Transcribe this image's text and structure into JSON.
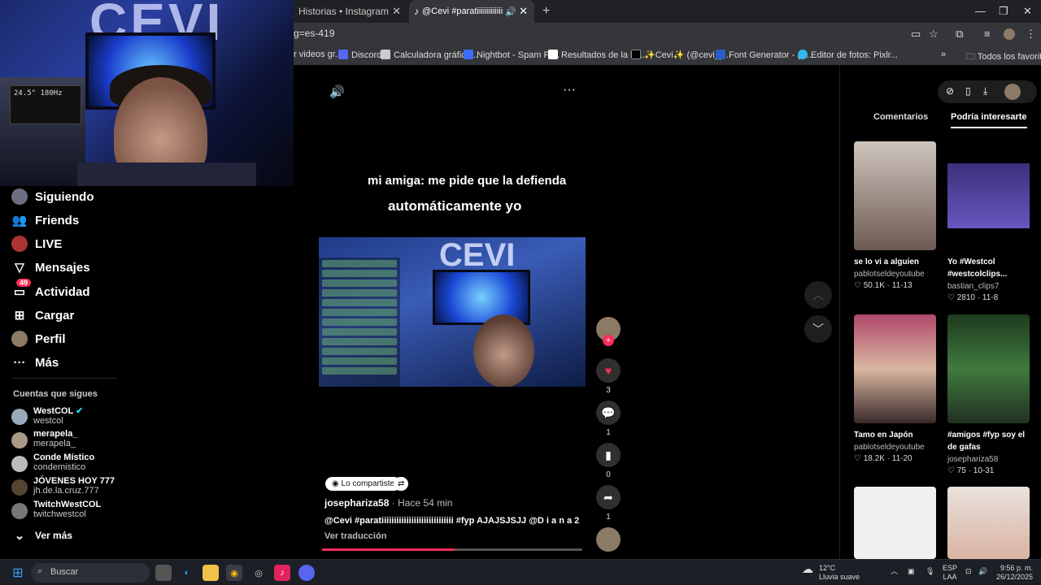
{
  "webcam": {
    "logo": "CEVI",
    "box_text": "24.5\" 180Hz"
  },
  "browser": {
    "tabs": [
      {
        "title": "Historias • Instagram"
      },
      {
        "title": "@Cevi #paratiiiiiiiiiiiiiiiiiiiiiiiiiiiiii"
      }
    ],
    "new_tab": "+",
    "url": "g=es-419",
    "bookmarks": [
      {
        "label": "r videos gr...",
        "color": "#888888"
      },
      {
        "label": "Discord",
        "color": "#5865f2"
      },
      {
        "label": "Calculadora gráfica...",
        "color": "#cccccc"
      },
      {
        "label": "Nightbot - Spam Pr...",
        "color": "#3b6cff"
      },
      {
        "label": "Resultados de la bú...",
        "color": "#ffffff"
      },
      {
        "label": "✨Cevi✨ (@cevi_y...",
        "color": "#000000"
      },
      {
        "label": "Font Generator - (ℭ...",
        "color": "#2b5ccc"
      },
      {
        "label": "Editor de fotos: Pixlr...",
        "color": "#33b6e8"
      }
    ],
    "all_favorites": "Todos los favoritos"
  },
  "sidebar": {
    "nav": [
      {
        "label": "Siguiendo",
        "icon": "following-avatar-icon"
      },
      {
        "label": "Friends",
        "icon": "friends-icon"
      },
      {
        "label": "LIVE",
        "icon": "live-avatar-icon"
      },
      {
        "label": "Mensajes",
        "icon": "messages-icon"
      },
      {
        "label": "Actividad",
        "icon": "activity-icon",
        "badge": "49"
      },
      {
        "label": "Cargar",
        "icon": "upload-icon"
      },
      {
        "label": "Perfil",
        "icon": "profile-avatar-icon"
      },
      {
        "label": "Más",
        "icon": "more-icon"
      }
    ],
    "following_heading": "Cuentas que sigues",
    "accounts": [
      {
        "name": "WestCOL",
        "handle": "westcol",
        "verified": true
      },
      {
        "name": "merapela_",
        "handle": "merapela_"
      },
      {
        "name": "Conde Místico",
        "handle": "condemistico"
      },
      {
        "name": "JÓVENES HOY 777",
        "handle": "jh.de.la.cruz.777"
      },
      {
        "name": "TwitchWestCOL",
        "handle": "twitchwestcol"
      }
    ],
    "see_more": "Ver más"
  },
  "video": {
    "caption_line1": "mi amiga: me pide que la defienda",
    "caption_line2": "automáticamente yo",
    "clip_logo": "CEVI",
    "shared_pill": "Lo compartiste",
    "author": "josephariza58",
    "time": "· Hace 54 min",
    "description": "@Cevi #paratiiiiiiiiiiiiiiiiiiiiiiiiiiiii #fyp AJAJSJSJJ @D i a n a 2",
    "translate": "Ver traducción",
    "progress": 0.51,
    "likes": "3",
    "comments": "1",
    "saves": "0",
    "shares": "1"
  },
  "panel": {
    "tabs": [
      {
        "label": "Comentarios"
      },
      {
        "label": "Podría interesarte"
      }
    ],
    "cards": [
      {
        "title": "se lo vi a alguien",
        "user": "pablotseldeyoutube",
        "stats": "♡ 50.1K · 11-13",
        "color": "#d8cfc8"
      },
      {
        "title": "Yo #Westcol #westcolclips...",
        "user": "bastian_clips7",
        "stats": "♡ 2810 · 11-8",
        "color": "#3c2f7a"
      },
      {
        "title": "Tamo en Japón",
        "user": "pablotseldeyoutube",
        "stats": "♡ 18.2K · 11-20",
        "color": "#8a6a6f"
      },
      {
        "title": "#amigos #fyp soy el de gafas",
        "user": "josephariza58",
        "stats": "♡ 75 · 10-31",
        "color": "#2f5a2f"
      },
      {
        "title": "",
        "user": "",
        "stats": "",
        "color": "#f0f0f0"
      },
      {
        "title": "",
        "user": "",
        "stats": "",
        "color": "#d9b3a3"
      }
    ]
  },
  "taskbar": {
    "search": "Buscar",
    "weather_temp": "12°C",
    "weather_desc": "Lluvia suave",
    "lang1": "ESP",
    "lang2": "LAA",
    "time": "9:56 p. m.",
    "date": "26/12/2025"
  }
}
